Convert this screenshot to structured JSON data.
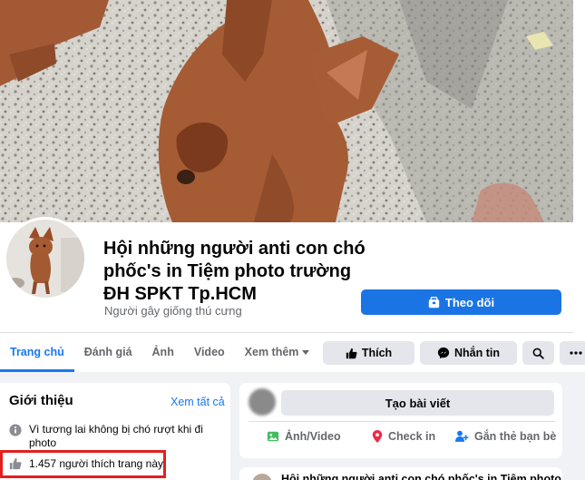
{
  "page": {
    "title": "Hội những người anti con chó phốc's in Tiệm photo trường ĐH SPKT Tp.HCM",
    "category": "Người gây giống thú cưng",
    "follow_label": "Theo dõi"
  },
  "tabs": [
    {
      "label": "Trang chủ",
      "active": true
    },
    {
      "label": "Đánh giá"
    },
    {
      "label": "Ảnh"
    },
    {
      "label": "Video"
    },
    {
      "label": "Xem thêm"
    }
  ],
  "actions": {
    "like_label": "Thích",
    "message_label": "Nhắn tin"
  },
  "intro": {
    "title": "Giới thiệu",
    "see_all": "Xem tất cả",
    "about": "Vì tương lai không bị chó rượt khi đi photo",
    "likes": "1.457 người thích trang này"
  },
  "composer": {
    "create_post": "Tạo bài viết",
    "photo_video": "Ảnh/Video",
    "check_in": "Check in",
    "tag_friends": "Gắn thẻ bạn bè"
  },
  "post_preview": {
    "text": "Hội những người anti con chó phốc's in Tiệm photo"
  },
  "colors": {
    "accent": "#1877f2",
    "follow_button": "#1b74e4",
    "highlight_box": "#e41e1e",
    "checkin_icon": "#f02849",
    "photo_icon": "#45bd62",
    "tag_icon": "#1877f2"
  }
}
